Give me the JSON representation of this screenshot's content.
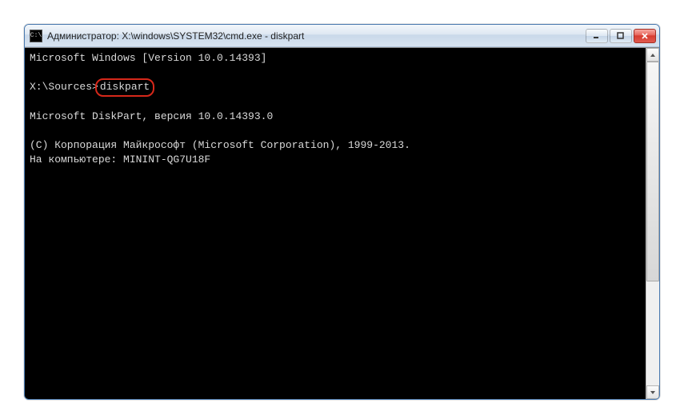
{
  "window": {
    "title": "Администратор: X:\\windows\\SYSTEM32\\cmd.exe - diskpart"
  },
  "console": {
    "line1": "Microsoft Windows [Version 10.0.14393]",
    "prompt": "X:\\Sources>",
    "command": "diskpart",
    "line2": "Microsoft DiskPart, версия 10.0.14393.0",
    "line3": "(C) Корпорация Майкрософт (Microsoft Corporation), 1999-2013.",
    "line4": "На компьютере: MININT-QG7U18F"
  }
}
